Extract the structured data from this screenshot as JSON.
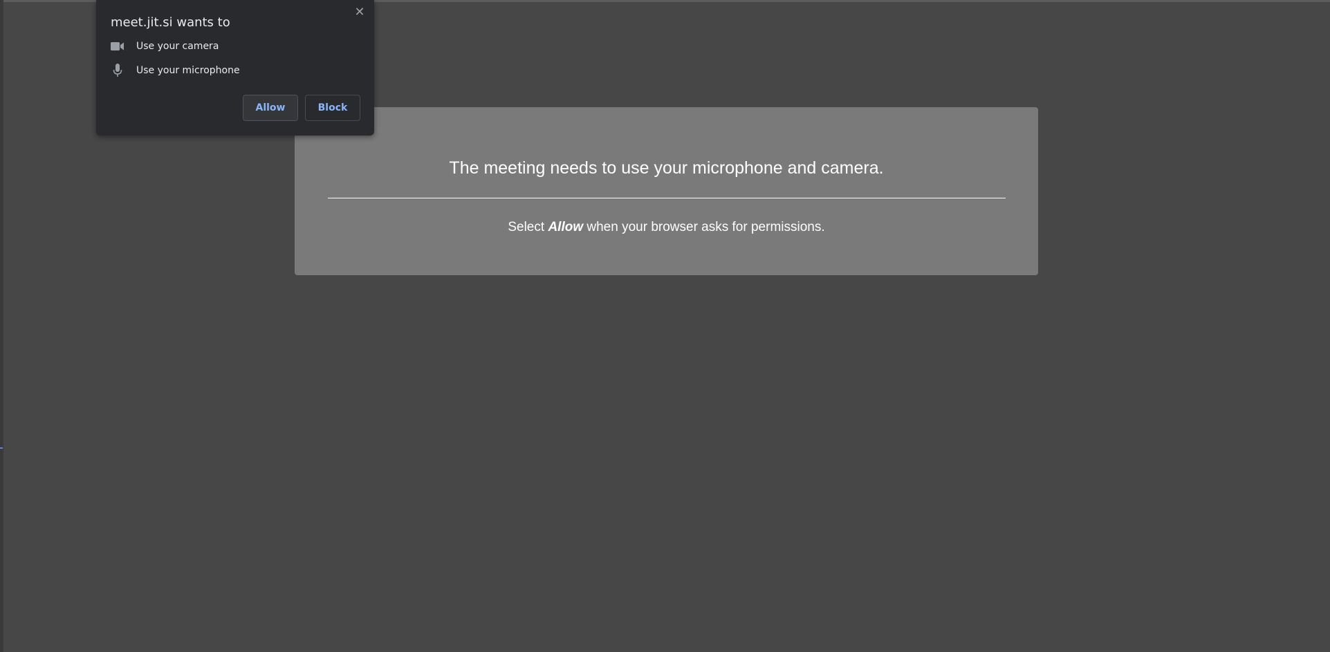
{
  "permission_popup": {
    "title": "meet.jit.si wants to",
    "close_icon": "close-icon",
    "permissions": [
      {
        "icon": "camera-icon",
        "label": "Use your camera"
      },
      {
        "icon": "microphone-icon",
        "label": "Use your microphone"
      }
    ],
    "allow_label": "Allow",
    "block_label": "Block",
    "accent_color": "#8ab4f8"
  },
  "card": {
    "title": "The meeting needs to use your microphone and camera.",
    "instruction_prefix": "Select",
    "instruction_emphasis": "Allow",
    "instruction_suffix": "when your browser asks for permissions."
  }
}
